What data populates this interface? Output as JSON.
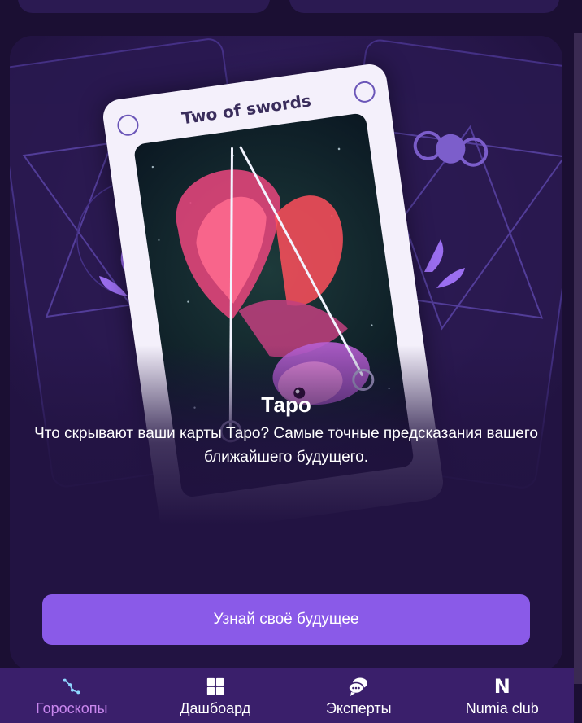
{
  "tarot_card": {
    "card_name": "Two of swords"
  },
  "hero": {
    "title": "Таро",
    "description": "Что скрывают ваши карты Таро? Самые точные предсказания вашего ближайшего будущего.",
    "cta_label": "Узнай своё будущее"
  },
  "bottom_nav": {
    "items": [
      {
        "label": "Гороскопы",
        "icon": "constellation-icon",
        "active": true
      },
      {
        "label": "Дашбоард",
        "icon": "dashboard-grid-icon",
        "active": false
      },
      {
        "label": "Эксперты",
        "icon": "chat-bubbles-icon",
        "active": false
      },
      {
        "label": "Numia club",
        "icon": "numia-logo-icon",
        "active": false
      }
    ]
  },
  "colors": {
    "background": "#1b0f33",
    "card_background": "#221342",
    "accent_button": "#8a5ae8",
    "nav_background": "#3a1f6b",
    "nav_active": "#c987ee"
  }
}
